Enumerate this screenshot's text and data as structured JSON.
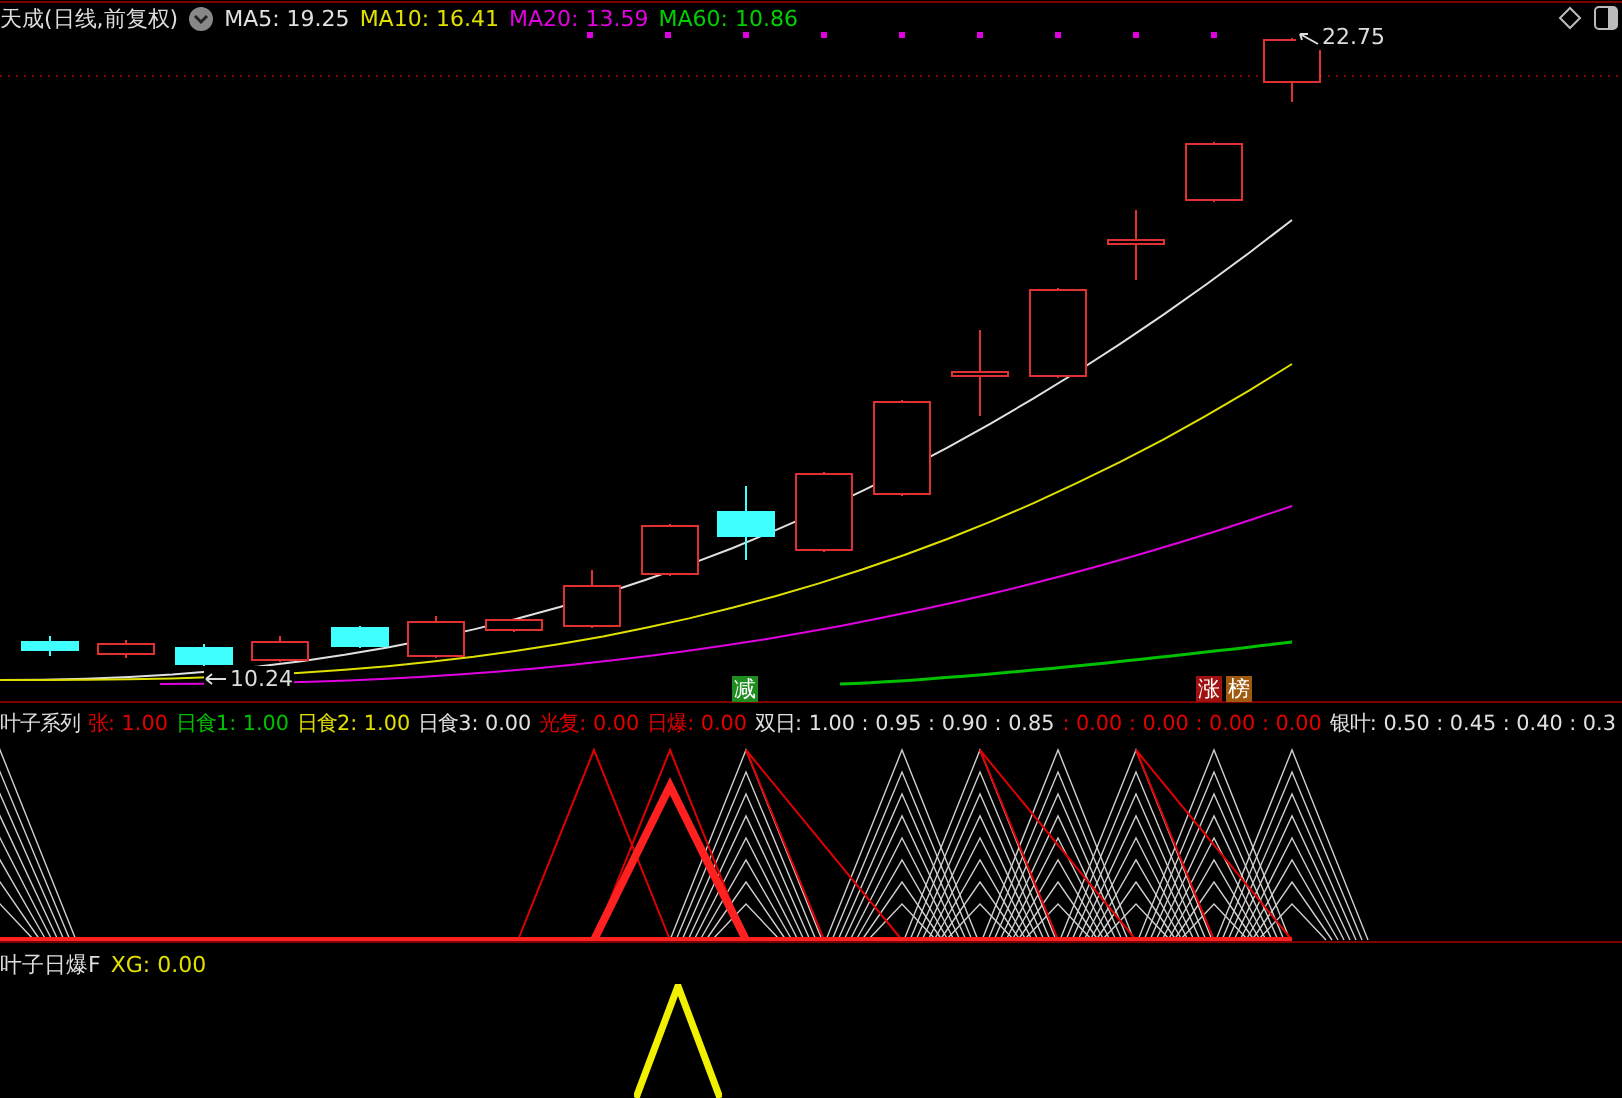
{
  "main_panel": {
    "title": "天成(日线,前复权)",
    "indicators": [
      {
        "label": "MA5: 19.25",
        "color": "#e0e0e0"
      },
      {
        "label": "MA10: 16.41",
        "color": "#e0e000"
      },
      {
        "label": "MA20: 13.59",
        "color": "#e000e0"
      },
      {
        "label": "MA60: 10.86",
        "color": "#00d000"
      }
    ],
    "high_label": "22.75",
    "low_label": "10.24",
    "signals": [
      {
        "text": "减",
        "color": "#1e8c1e"
      },
      {
        "text": "涨",
        "color": "#a01010"
      },
      {
        "text": "榜",
        "color": "#a05a10"
      }
    ]
  },
  "indicator_panel": {
    "title": "叶子系列",
    "values": [
      {
        "label": "张: 1.00",
        "color": "#e00000"
      },
      {
        "label": "日食1: 1.00",
        "color": "#00c000"
      },
      {
        "label": "日食2: 1.00",
        "color": "#e0e000"
      },
      {
        "label": "日食3: 0.00",
        "color": "#e0e0e0"
      },
      {
        "label": "光复: 0.00",
        "color": "#e00000"
      },
      {
        "label": "日爆: 0.00",
        "color": "#e00000"
      },
      {
        "label": "双日: 1.00 : 0.95 : 0.90 : 0.85",
        "color": "#e0e0e0"
      },
      {
        "label": ": 0.00 : 0.00 : 0.00 : 0.00",
        "color": "#e00000"
      },
      {
        "label": "银叶: 0.50 : 0.45 : 0.40 : 0.3",
        "color": "#e0e0e0"
      }
    ]
  },
  "bottom_panel": {
    "title": "叶子日爆F",
    "values": [
      {
        "label": "XG: 0.00",
        "color": "#e0e000"
      }
    ]
  }
}
